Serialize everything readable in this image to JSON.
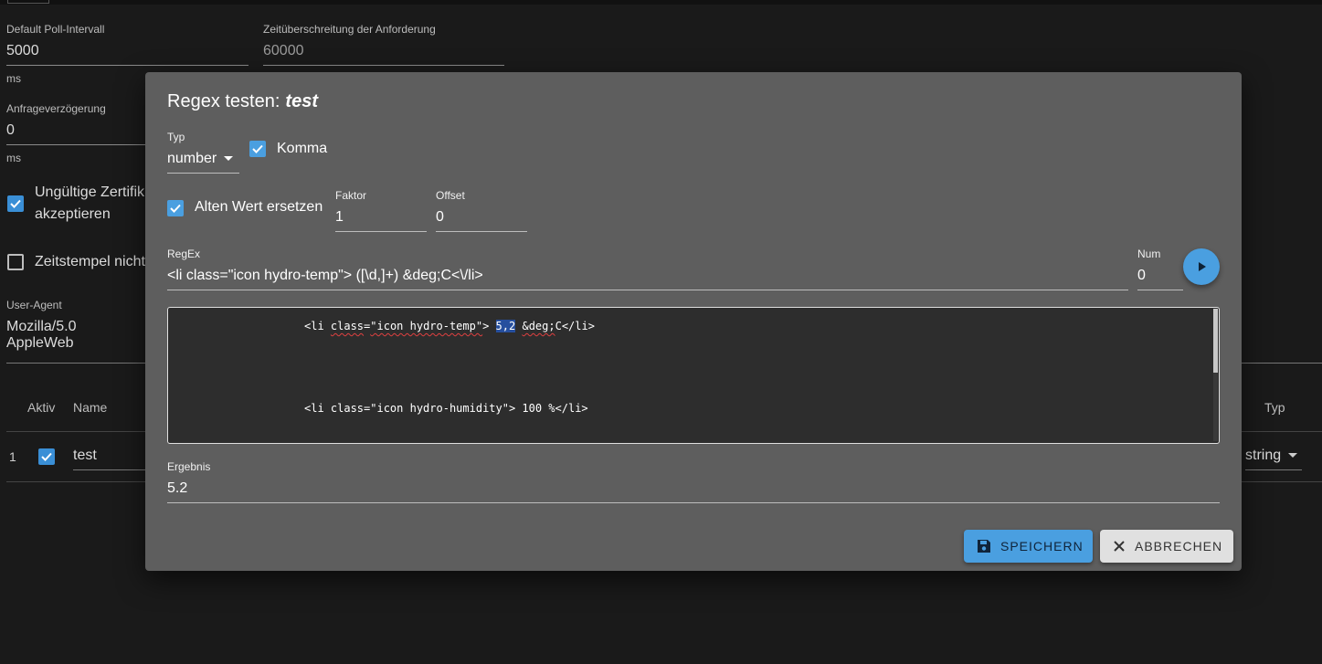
{
  "background": {
    "poll": {
      "label": "Default Poll-Intervall",
      "value": "5000",
      "unit": "ms"
    },
    "timeout": {
      "label": "Zeitüberschreitung der Anforderung",
      "value": "60000"
    },
    "delay": {
      "label": "Anfrageverzögerung",
      "value": "0",
      "unit": "ms"
    },
    "invalid_cert": {
      "line1": "Ungültige Zertifik",
      "line2": "akzeptieren"
    },
    "timestamp": "Zeitstempel nicht",
    "user_agent": {
      "label": "User-Agent",
      "value": "Mozilla/5.0 AppleWeb"
    },
    "table": {
      "headers": {
        "active": "Aktiv",
        "name": "Name",
        "type": "Typ"
      },
      "row": {
        "index": "1",
        "name": "test",
        "type": "string"
      }
    }
  },
  "dialog": {
    "title": "Regex testen:",
    "title_name": "test",
    "type": {
      "label": "Typ",
      "value": "number"
    },
    "comma": {
      "label": "Komma",
      "checked": true
    },
    "replace_old": {
      "label": "Alten Wert ersetzen",
      "checked": true
    },
    "factor": {
      "label": "Faktor",
      "value": "1"
    },
    "offset": {
      "label": "Offset",
      "value": "0"
    },
    "regex": {
      "label": "RegEx",
      "value": "<li class=\"icon hydro-temp\"> ([\\d,]+) &deg;C<\\/li>"
    },
    "num": {
      "label": "Num",
      "value": "0"
    },
    "code": {
      "line1_pre": "<li ",
      "line1_class": "class",
      "line1_eq": "=",
      "line1_str": "\"icon hydro-temp\"",
      "line1_gt": "> ",
      "line1_match": "5,2",
      "line1_sp": " ",
      "line1_deg": "&deg;",
      "line1_post": "C</li>",
      "line2": "<li class=\"icon hydro-humidity\"> 100 %</li>"
    },
    "result": {
      "label": "Ergebnis",
      "value": "5.2"
    },
    "save_label": "SPEICHERN",
    "cancel_label": "ABBRECHEN"
  },
  "colors": {
    "accent": "#4a9fe0",
    "dialog_bg": "#5e5e5e",
    "editor_bg": "#2d2d2d"
  }
}
